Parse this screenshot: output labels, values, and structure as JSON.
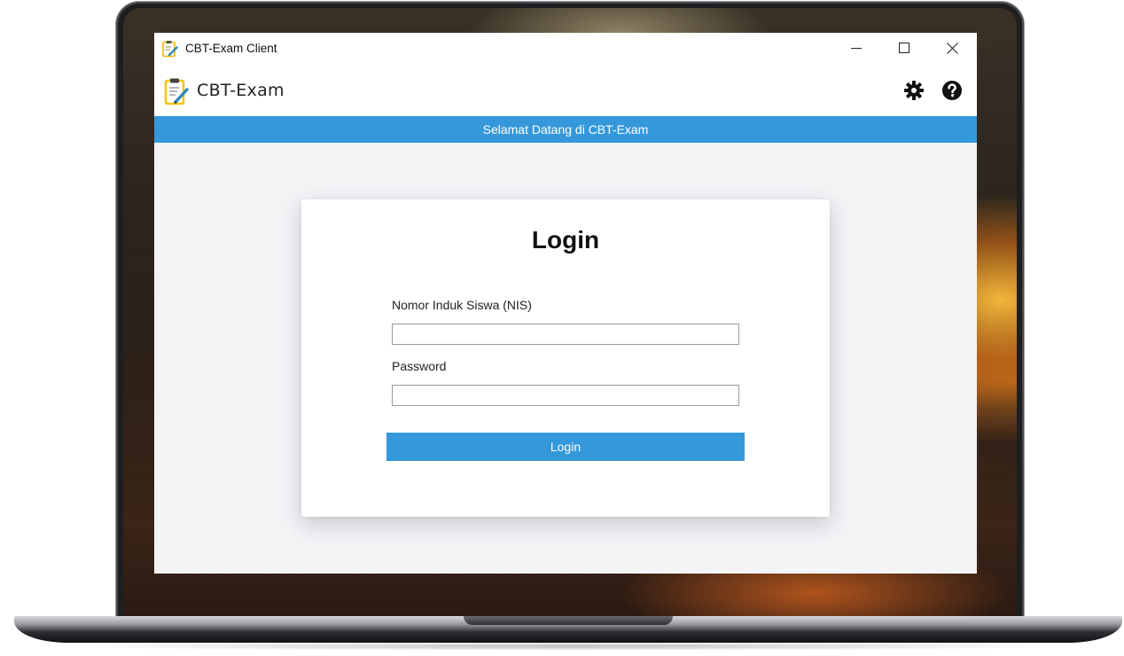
{
  "window": {
    "title": "CBT-Exam Client",
    "controls": {
      "minimize": "—",
      "maximize": "☐",
      "close": "✕"
    }
  },
  "appbar": {
    "app_name": "CBT-Exam",
    "icons": [
      "clipboard-pencil-icon",
      "gear-icon",
      "help-icon"
    ]
  },
  "banner": {
    "text": "Selamat Datang di CBT-Exam"
  },
  "login": {
    "heading": "Login",
    "nis_label": "Nomor Induk Siswa (NIS)",
    "nis_value": "",
    "password_label": "Password",
    "password_value": "",
    "button_label": "Login"
  },
  "colors": {
    "accent": "#3498db",
    "logo_yellow": "#f5c518",
    "content_background": "#f4f3f6"
  }
}
